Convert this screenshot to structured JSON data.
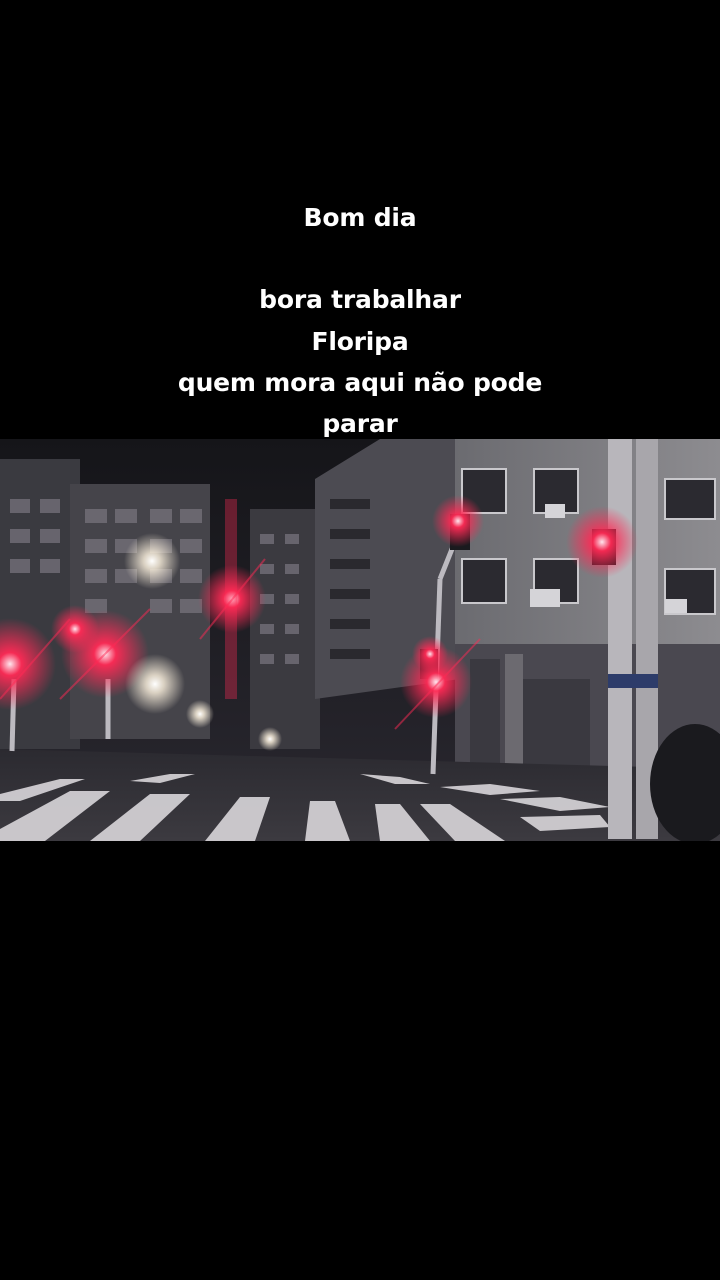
{
  "caption": {
    "line1": "Bom dia",
    "line2": "bora trabalhar",
    "line3": "Floripa",
    "line4": "quem mora aqui não pode",
    "line5": "parar"
  },
  "colors": {
    "background": "#000000",
    "caption_text": "#ffffff",
    "traffic_light_red": "#ff2a55"
  },
  "video": {
    "scene": "night street crossing with red traffic lights"
  }
}
